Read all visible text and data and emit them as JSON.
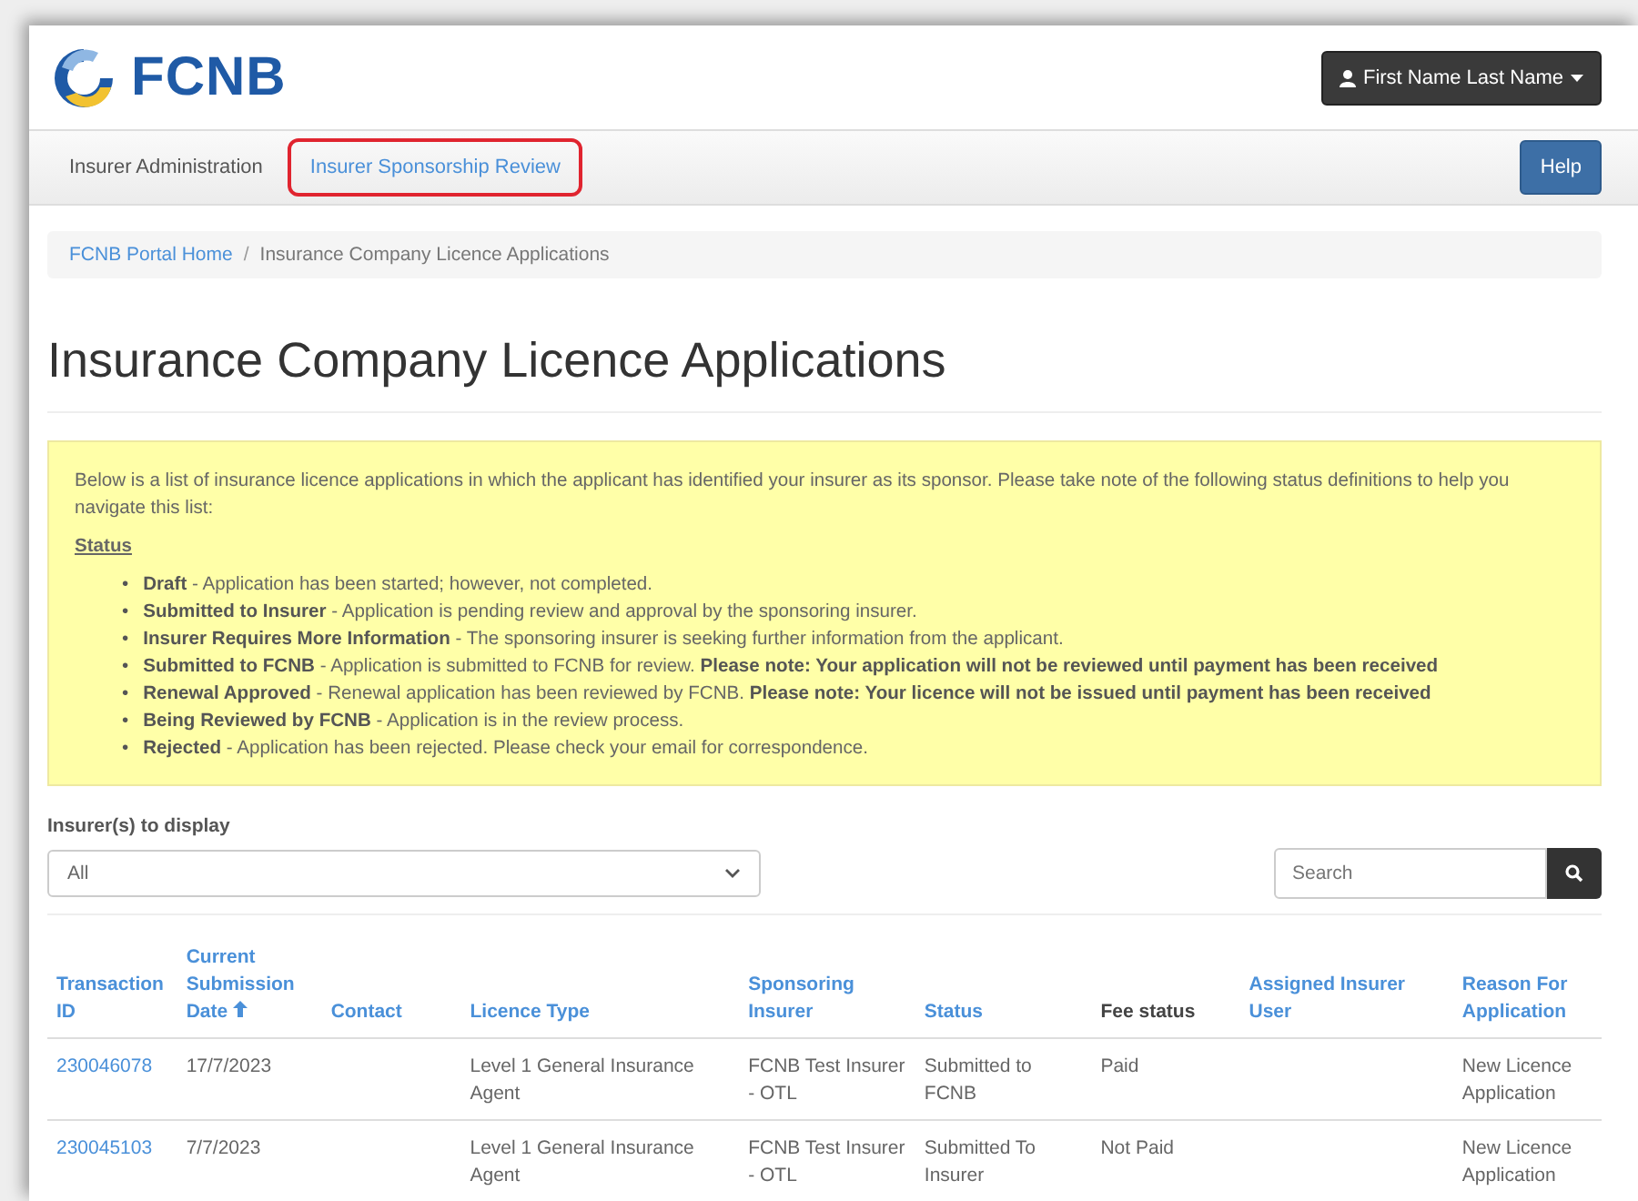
{
  "header": {
    "logo_text": "FCNB",
    "user_menu": "First Name Last Name"
  },
  "nav": {
    "tabs": [
      {
        "label": "Insurer Administration",
        "selected": false,
        "highlighted": false
      },
      {
        "label": "Insurer Sponsorship Review",
        "selected": true,
        "highlighted": true
      }
    ],
    "help": "Help"
  },
  "breadcrumb": [
    {
      "label": "FCNB Portal Home",
      "link": true
    },
    {
      "label": "Insurance Company Licence Applications",
      "link": false
    }
  ],
  "breadcrumb_separator": "/",
  "title": "Insurance Company Licence Applications",
  "notice": {
    "intro": "Below is a list of insurance licence applications in which the applicant has identified your insurer as its sponsor. Please take note of the following status definitions to help you navigate this list:",
    "heading": "Status",
    "bullet": "•",
    "items": [
      "**Draft** - Application has been started; however, not completed.",
      "**Submitted to Insurer** - Application is pending review and approval by the sponsoring insurer.",
      "**Insurer Requires More Information** - The sponsoring insurer is seeking further information from the applicant.",
      "**Submitted to FCNB** - Application is submitted to FCNB for review. **Please note: Your application will not be reviewed until payment has been received**",
      "**Renewal Approved** - Renewal application has been reviewed by FCNB. **Please note: Your licence will not be issued until payment has been received**",
      "**Being Reviewed by FCNB** - Application is in the review process.",
      "**Rejected** - Application has been rejected. Please check your email for correspondence."
    ]
  },
  "filter": {
    "label": "Insurer(s) to display",
    "value": "All",
    "search_placeholder": "Search"
  },
  "table": {
    "columns": [
      {
        "label": "Transaction ID",
        "sortable": true,
        "sorted": false
      },
      {
        "label": "Current Submission Date",
        "sortable": true,
        "sorted": true
      },
      {
        "label": "Contact",
        "sortable": true,
        "sorted": false
      },
      {
        "label": "Licence Type",
        "sortable": true,
        "sorted": false
      },
      {
        "label": "Sponsoring Insurer",
        "sortable": true,
        "sorted": false
      },
      {
        "label": "Status",
        "sortable": true,
        "sorted": false
      },
      {
        "label": "Fee status",
        "sortable": false,
        "sorted": false
      },
      {
        "label": "Assigned Insurer User",
        "sortable": true,
        "sorted": false
      },
      {
        "label": "Reason For Application",
        "sortable": true,
        "sorted": false
      }
    ],
    "rows": [
      [
        "230046078",
        "17/7/2023",
        "",
        "Level 1 General Insurance Agent",
        "FCNB Test Insurer - OTL",
        "Submitted to FCNB",
        "Paid",
        "",
        "New Licence Application"
      ],
      [
        "230045103",
        "7/7/2023",
        "",
        "Level 1 General Insurance Agent",
        "FCNB Test Insurer - OTL",
        "Submitted To Insurer",
        "Not Paid",
        "",
        "New Licence Application"
      ]
    ]
  }
}
